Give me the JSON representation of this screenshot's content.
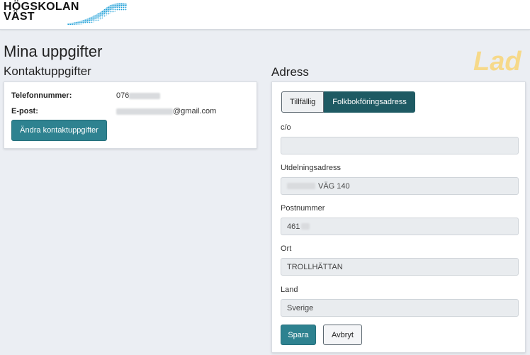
{
  "header": {
    "logo_line1": "HÖGSKOLAN",
    "logo_line2": "VÄST"
  },
  "page": {
    "title": "Mina uppgifter",
    "loading_text": "Lad"
  },
  "contact": {
    "title": "Kontaktuppgifter",
    "phone_label": "Telefonnummer:",
    "phone_value_visible": "076",
    "email_label": "E-post:",
    "email_value_visible": "@gmail.com",
    "edit_button": "Ändra kontaktuppgifter"
  },
  "address": {
    "title": "Adress",
    "tabs": [
      {
        "label": "Tillfällig",
        "active": false
      },
      {
        "label": "Folkbokföringsadress",
        "active": true
      }
    ],
    "fields": {
      "co": {
        "label": "c/o",
        "value": ""
      },
      "street": {
        "label": "Utdelningsadress",
        "value_visible": "VÄG 140"
      },
      "postal": {
        "label": "Postnummer",
        "value_visible": "461"
      },
      "city": {
        "label": "Ort",
        "value": "TROLLHÄTTAN"
      },
      "country": {
        "label": "Land",
        "value": "Sverige"
      }
    },
    "save_button": "Spara",
    "cancel_button": "Avbryt"
  },
  "colors": {
    "primary": "#2e8290",
    "tab_active": "#1e5a63",
    "loading": "#f6d98a",
    "background": "#ebeef3"
  }
}
